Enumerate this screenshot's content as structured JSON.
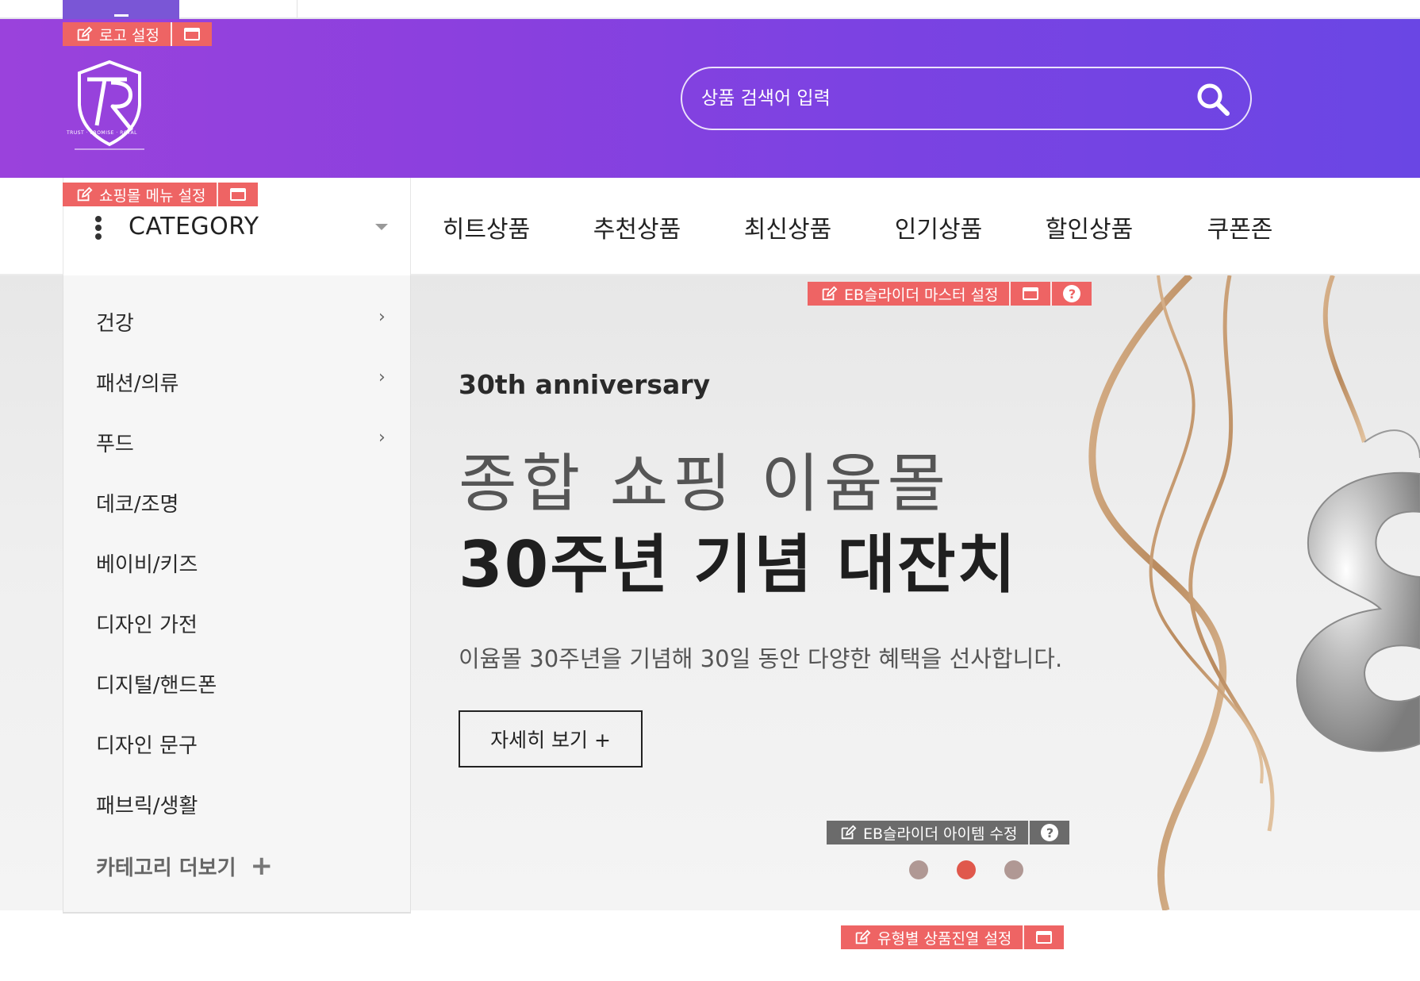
{
  "admin_tags": {
    "logo": "로고 설정",
    "shop_menu": "쇼핑몰 메뉴 설정",
    "eb_slider_master": "EB슬라이더 마스터 설정",
    "eb_slider_item": "EB슬라이더 아이템 수정",
    "type_display": "유형별 상품진열 설정"
  },
  "logo": {
    "letters": "TR",
    "tagline": "TRUST · PROMISE · ROYAL"
  },
  "search": {
    "placeholder": "상품 검색어 입력"
  },
  "category": {
    "header": "CATEGORY",
    "items": [
      {
        "label": "건강",
        "has_sub": true
      },
      {
        "label": "패션/의류",
        "has_sub": true
      },
      {
        "label": "푸드",
        "has_sub": true
      },
      {
        "label": "데코/조명",
        "has_sub": false
      },
      {
        "label": "베이비/키즈",
        "has_sub": false
      },
      {
        "label": "디자인 가전",
        "has_sub": false
      },
      {
        "label": "디지털/핸드폰",
        "has_sub": false
      },
      {
        "label": "디자인 문구",
        "has_sub": false
      },
      {
        "label": "패브릭/생활",
        "has_sub": false
      }
    ],
    "more": "카테고리 더보기"
  },
  "nav": {
    "items": [
      "히트상품",
      "추천상품",
      "최신상품",
      "인기상품",
      "할인상품",
      "쿠폰존"
    ]
  },
  "banner": {
    "subtitle": "30th anniversary",
    "title_line1": "종합 쇼핑 이윰몰",
    "title_line2": "30주년 기념 대잔치",
    "description": "이윰몰 30주년을 기념해 30일 동안 다양한 혜택을 선사합니다.",
    "button": "자세히 보기 +",
    "slide_count": 3,
    "active_slide": 2
  },
  "colors": {
    "header_start": "#9a42dc",
    "header_end": "#6a46e4",
    "admin_tag": "#ee6464",
    "admin_tag_dark": "#6b6b6b",
    "dot_active": "#e0584c",
    "dot_inactive": "#b09894"
  },
  "icons": {
    "search": "search-icon",
    "edit": "edit-icon",
    "window": "window-icon",
    "help": "help-icon",
    "chevron": "chevron-right-icon",
    "plus": "plus-icon",
    "kebab": "kebab-icon",
    "caret": "caret-down-icon"
  }
}
